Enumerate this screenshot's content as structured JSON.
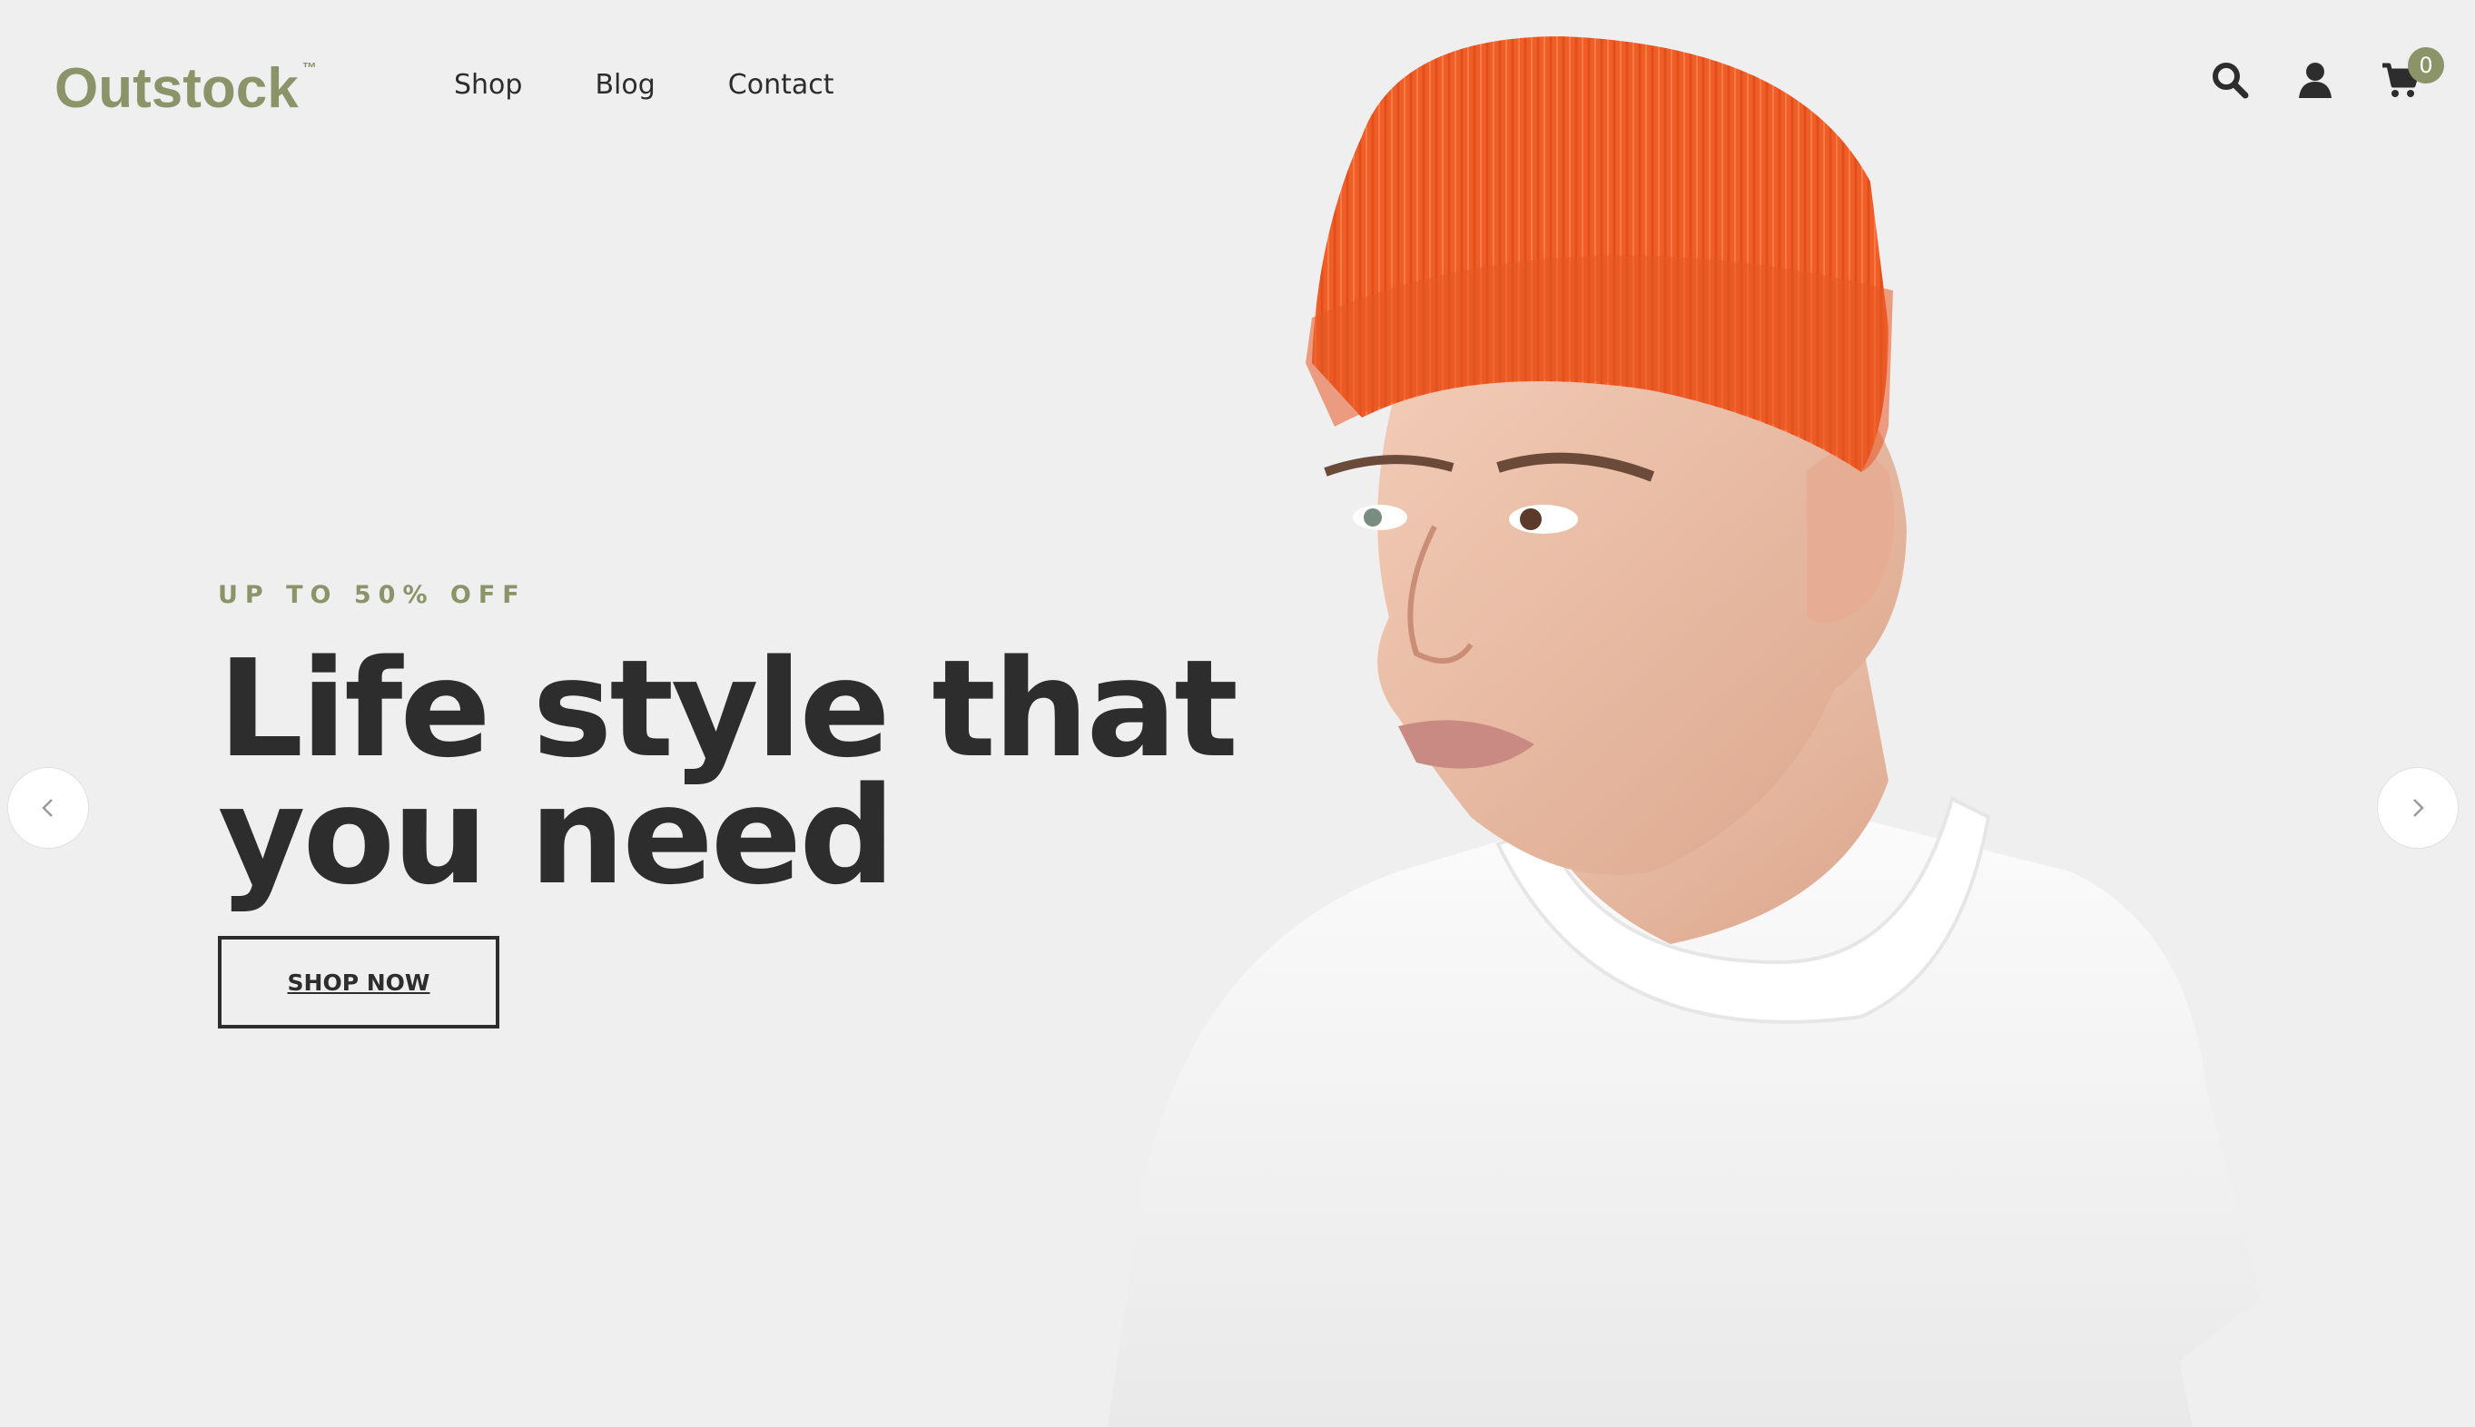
{
  "header": {
    "logo": "Outstock",
    "logo_tm": "™",
    "nav": [
      {
        "label": "Shop"
      },
      {
        "label": "Blog"
      },
      {
        "label": "Contact"
      }
    ],
    "icons": [
      "search-icon",
      "user-icon",
      "cart-icon"
    ],
    "cart_count": "0"
  },
  "hero": {
    "eyebrow": "UP TO 50% OFF",
    "headline": "Life style that you need",
    "cta_label": "SHOP NOW"
  },
  "slider": {
    "prev": "chevron-left-icon",
    "next": "chevron-right-icon"
  },
  "colors": {
    "background": "#efefef",
    "accent": "#8a9468",
    "text": "#2d2d2d",
    "beanie": "#f0602a"
  }
}
